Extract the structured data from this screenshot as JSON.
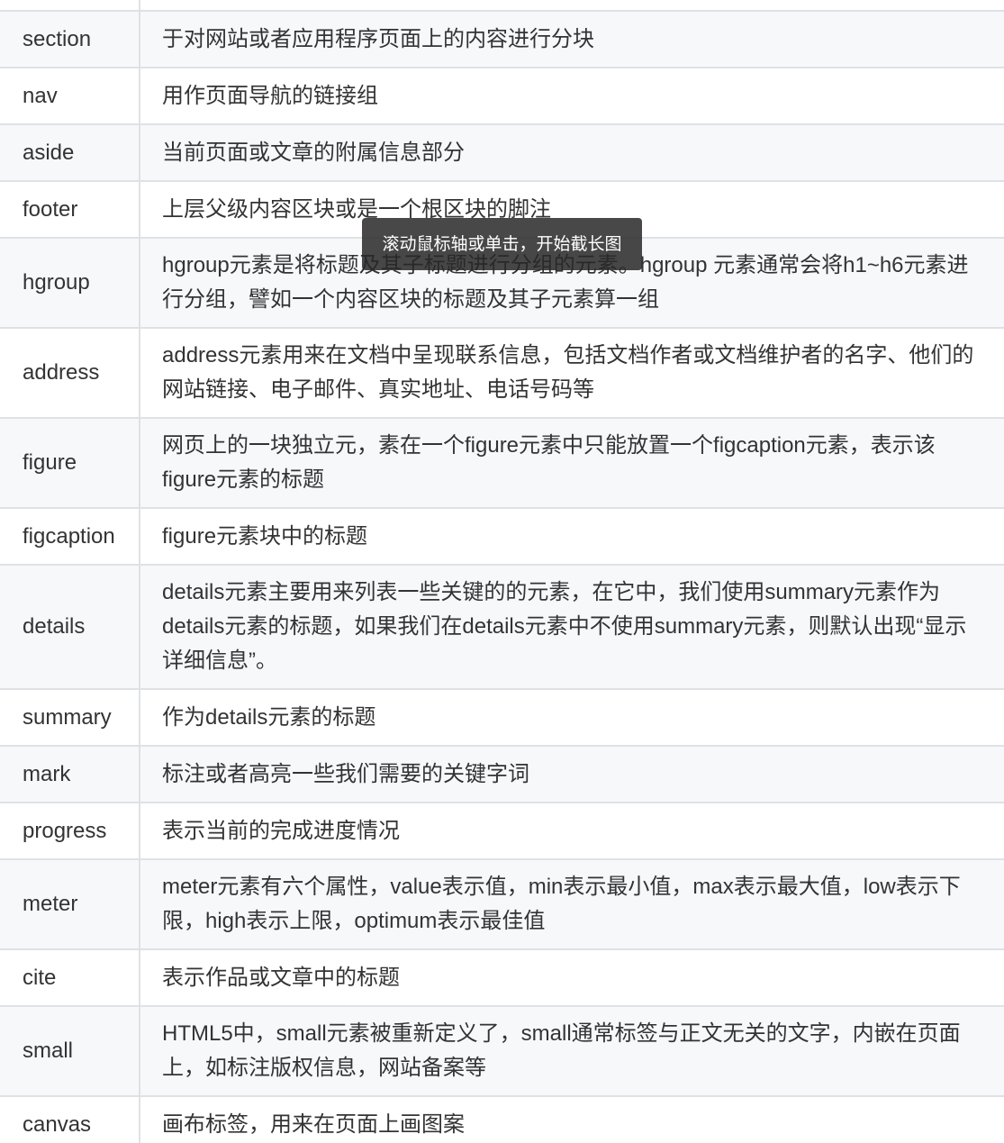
{
  "rows": [
    {
      "tag": "section",
      "desc": "于对网站或者应用程序页面上的内容进行分块"
    },
    {
      "tag": "nav",
      "desc": "用作页面导航的链接组"
    },
    {
      "tag": "aside",
      "desc": "当前页面或文章的附属信息部分"
    },
    {
      "tag": "footer",
      "desc": "上层父级内容区块或是一个根区块的脚注"
    },
    {
      "tag": "hgroup",
      "desc": "hgroup元素是将标题及其子标题进行分组的元素。hgroup 元素通常会将h1~h6元素进行分组，譬如一个内容区块的标题及其子元素算一组"
    },
    {
      "tag": "address",
      "desc": "address元素用来在文档中呈现联系信息，包括文档作者或文档维护者的名字、他们的网站链接、电子邮件、真实地址、电话号码等"
    },
    {
      "tag": "figure",
      "desc": "网页上的一块独立元，素在一个figure元素中只能放置一个figcaption元素，表示该figure元素的标题"
    },
    {
      "tag": "figcaption",
      "desc": "figure元素块中的标题"
    },
    {
      "tag": "details",
      "desc": "details元素主要用来列表一些关键的的元素，在它中，我们使用summary元素作为details元素的标题，如果我们在details元素中不使用summary元素，则默认出现“显示详细信息”。"
    },
    {
      "tag": "summary",
      "desc": "作为details元素的标题"
    },
    {
      "tag": "mark",
      "desc": "标注或者高亮一些我们需要的关键字词"
    },
    {
      "tag": "progress",
      "desc": "表示当前的完成进度情况"
    },
    {
      "tag": "meter",
      "desc": "meter元素有六个属性，value表示值，min表示最小值，max表示最大值，low表示下限，high表示上限，optimum表示最佳值"
    },
    {
      "tag": "cite",
      "desc": "表示作品或文章中的标题"
    },
    {
      "tag": "small",
      "desc": "HTML5中，small元素被重新定义了，small通常标签与正文无关的文字，内嵌在页面上，如标注版权信息，网站备案等"
    },
    {
      "tag": "canvas",
      "desc": "画布标签，用来在页面上画图案"
    }
  ],
  "tooltip": {
    "text": "滚动鼠标轴或单击，开始截长图"
  }
}
